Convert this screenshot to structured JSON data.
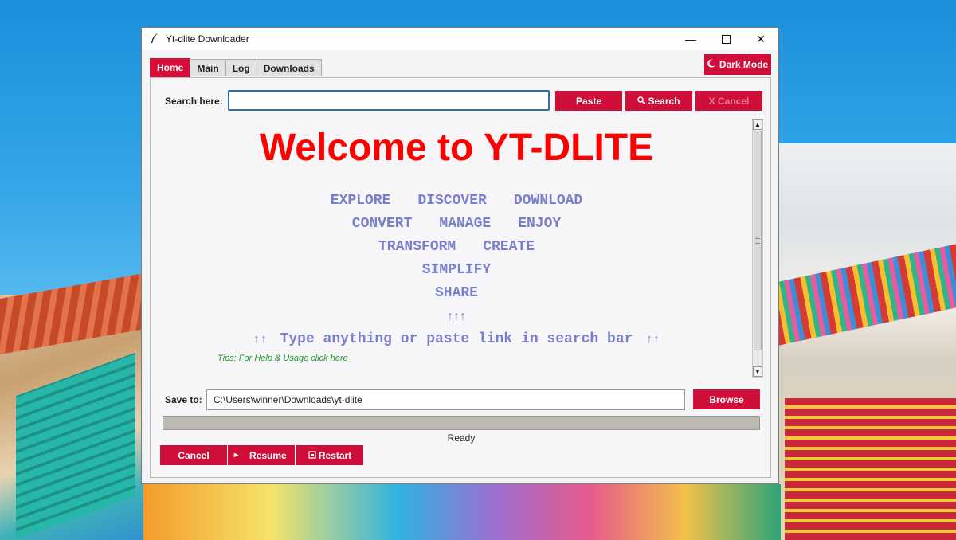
{
  "window": {
    "title": "Yt-dlite Downloader",
    "controls": {
      "minimize": "—",
      "close": "✕"
    }
  },
  "tabs": [
    {
      "label": "Home",
      "active": true
    },
    {
      "label": "Main",
      "active": false
    },
    {
      "label": "Log",
      "active": false
    },
    {
      "label": "Downloads",
      "active": false
    }
  ],
  "dark_mode": {
    "label": "Dark Mode",
    "icon": "moon-icon"
  },
  "search": {
    "label": "Search here:",
    "value": "",
    "paste_label": "Paste",
    "search_label": "Search",
    "search_icon": "search-icon",
    "cancel_label": "X Cancel"
  },
  "welcome": {
    "title": "Welcome to YT-DLITE",
    "rows": [
      [
        "EXPLORE",
        "DISCOVER",
        "DOWNLOAD"
      ],
      [
        "CONVERT",
        "MANAGE",
        "ENJOY"
      ],
      [
        "TRANSFORM",
        "CREATE"
      ],
      [
        "SIMPLIFY"
      ],
      [
        "SHARE"
      ]
    ],
    "arrows": "↑↑↑",
    "hint_arrows_left": "↑↑",
    "hint": "Type anything or paste link in search bar",
    "hint_arrows_right": "↑↑",
    "tips": "Tips: For Help & Usage click here"
  },
  "save": {
    "label": "Save to:",
    "path": "C:\\Users\\winner\\Downloads\\yt-dlite",
    "browse_label": "Browse"
  },
  "progress": {
    "fraction": 0,
    "status": "Ready"
  },
  "actions": {
    "cancel_label": "Cancel",
    "resume_label": "Resume",
    "resume_icon": "play-icon",
    "restart_label": "Restart",
    "restart_icon": "restart-icon"
  },
  "colors": {
    "accent": "#cf0f3a",
    "welcome_title": "#ff0000",
    "feature_words": "#7a7fcc",
    "tips": "#1d9a2a"
  }
}
